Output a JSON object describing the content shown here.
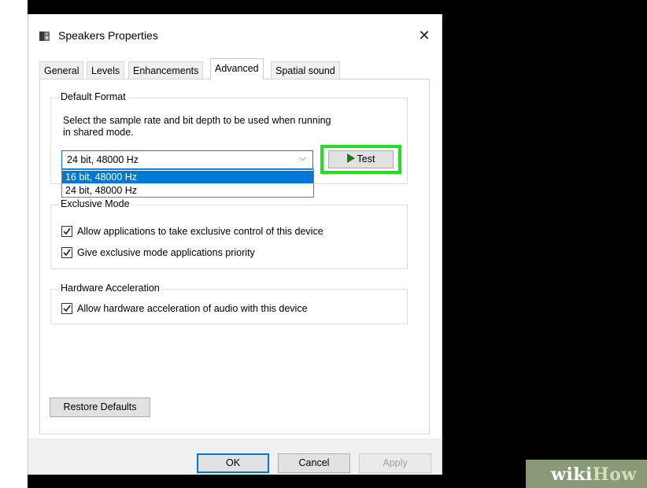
{
  "window": {
    "title": "Speakers Properties",
    "close_glyph": "✕"
  },
  "tabs": [
    {
      "label": "General"
    },
    {
      "label": "Levels"
    },
    {
      "label": "Enhancements"
    },
    {
      "label": "Advanced"
    },
    {
      "label": "Spatial sound"
    }
  ],
  "active_tab": "Advanced",
  "default_format": {
    "legend": "Default Format",
    "description_line1": "Select the sample rate and bit depth to be used when running",
    "description_line2": "in shared mode.",
    "selected_value": "24 bit, 48000 Hz",
    "arrow_glyph": "⌵",
    "options": [
      "16 bit, 48000 Hz",
      "24 bit, 48000 Hz"
    ],
    "highlighted_option": "16 bit, 48000 Hz",
    "test_label": "Test",
    "highlight_color": "#21e021"
  },
  "exclusive_mode": {
    "legend": "Exclusive Mode",
    "allow_exclusive": {
      "label": "Allow applications to take exclusive control of this device",
      "checked": true
    },
    "give_priority": {
      "label": "Give exclusive mode applications priority",
      "checked": true
    }
  },
  "hardware_acceleration": {
    "legend": "Hardware Acceleration",
    "allow_hw": {
      "label": "Allow hardware acceleration of audio with this device",
      "checked": true
    }
  },
  "buttons": {
    "restore_defaults": "Restore Defaults",
    "ok": "OK",
    "cancel": "Cancel",
    "apply": "Apply"
  },
  "watermark": {
    "wiki": "wiki",
    "how": "How"
  },
  "colors": {
    "accent": "#0078d7",
    "selection_bg": "#0078d7",
    "test_outline": "#21e021",
    "play_icon": "#1b7a1b"
  },
  "icons": [
    "speaker-icon",
    "close-icon",
    "chevron-down-icon",
    "play-icon",
    "checkmark-icon"
  ]
}
